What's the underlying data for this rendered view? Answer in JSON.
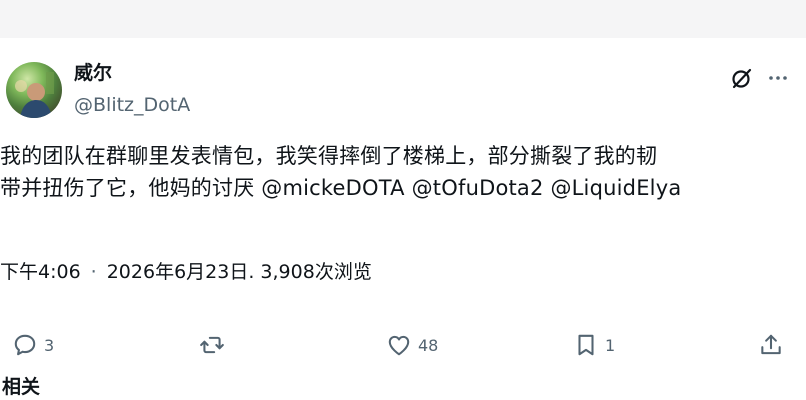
{
  "author": {
    "name": "威尔",
    "handle": "@Blitz_DotA"
  },
  "post": {
    "line1": "我的团队在群聊里发表情包，我笑得摔倒了楼梯上，部分撕裂了我的韧",
    "line2_prefix": "带并扭伤了它，他妈的讨厌 ",
    "mention1": "@mickeDOTA",
    "mention2": "@tOfuDota2",
    "mention3": "@LiquidElya"
  },
  "meta": {
    "time": "下午4:06",
    "separator": "·",
    "date": "2026年6月23日",
    "views": ". 3,908次浏览"
  },
  "actions": {
    "replies": "3",
    "retweets": "",
    "likes": "48",
    "bookmarks": "1"
  },
  "related_label": "相关",
  "icons": [
    "grok-icon",
    "more-icon",
    "reply-icon",
    "retweet-icon",
    "like-icon",
    "bookmark-icon",
    "share-icon"
  ],
  "colors": {
    "text": "#0f1419",
    "muted": "#536471",
    "topbar": "#f5f5f6"
  }
}
